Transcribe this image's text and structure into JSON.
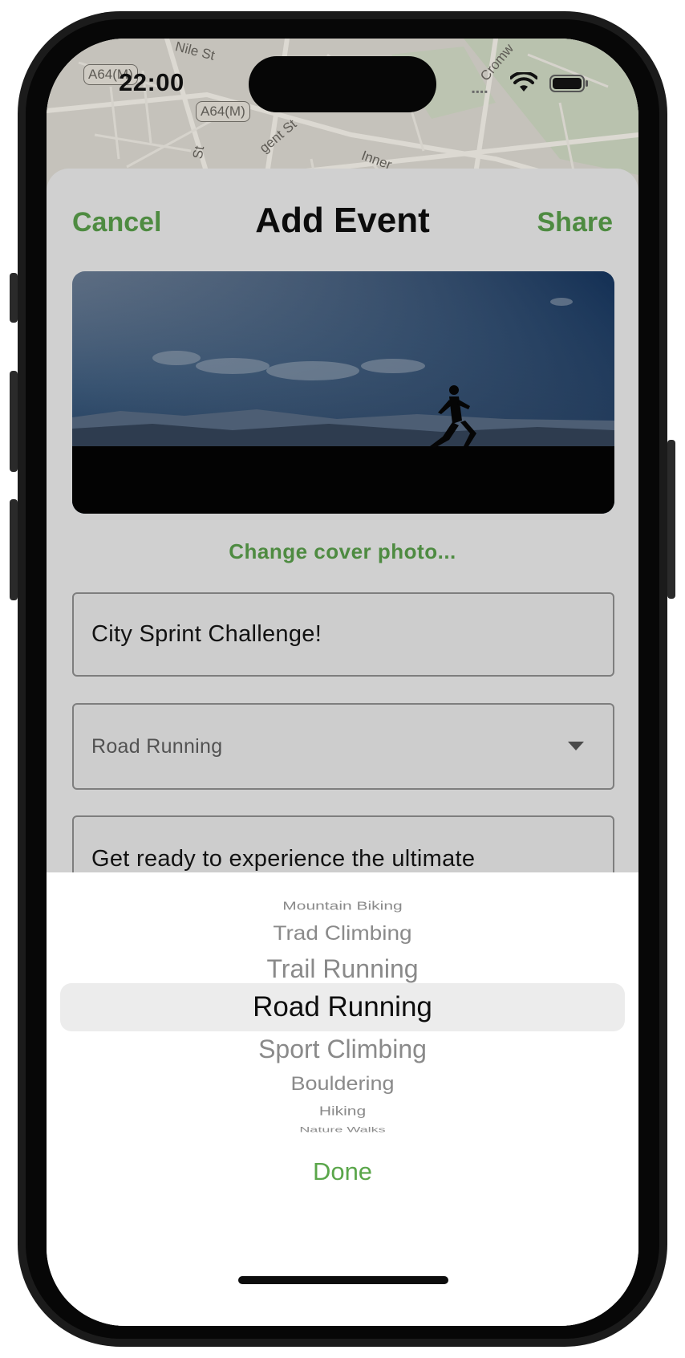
{
  "status_bar": {
    "time": "22:00"
  },
  "map": {
    "streets": [
      "Nile St",
      "Inner",
      "Cromw",
      "St",
      "gent St"
    ],
    "road_badges": [
      "A64(M)",
      "A64(M)"
    ]
  },
  "nav": {
    "cancel_label": "Cancel",
    "title": "Add Event",
    "share_label": "Share"
  },
  "cover": {
    "change_label": "Change cover photo..."
  },
  "form": {
    "title_value": "City Sprint Challenge!",
    "type_value": "Road Running",
    "description_value": "Get ready to experience the ultimate"
  },
  "picker": {
    "items": [
      "Mountain Biking",
      "Trad Climbing",
      "Trail Running",
      "Road Running",
      "Sport Climbing",
      "Bouldering",
      "Hiking",
      "Nature Walks"
    ],
    "selected": "Road Running",
    "done_label": "Done"
  },
  "colors": {
    "accent": "#4e8b41",
    "done": "#5aa64a"
  }
}
